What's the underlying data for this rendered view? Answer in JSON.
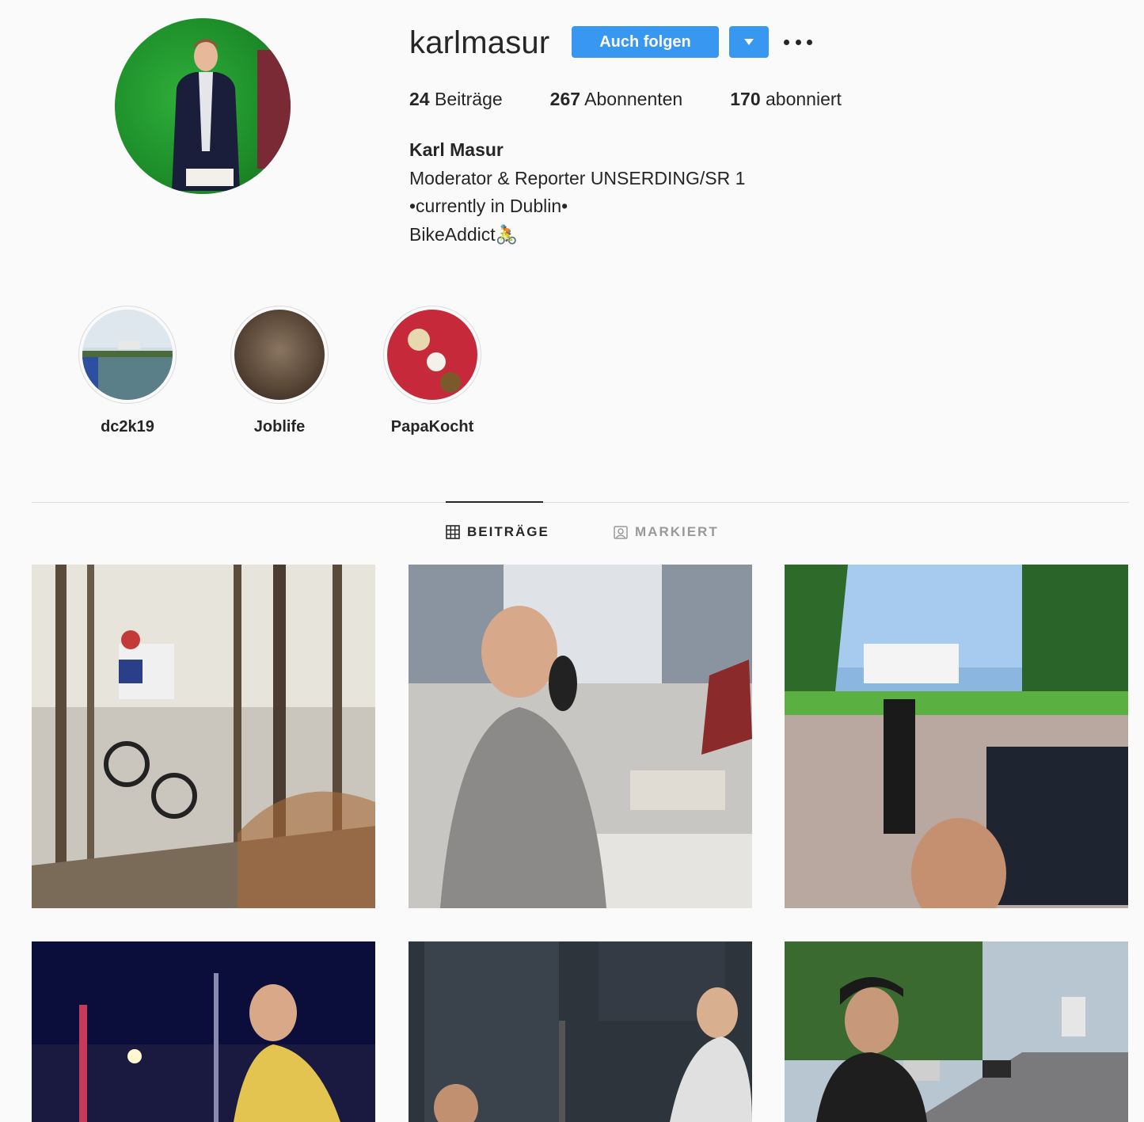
{
  "profile": {
    "username": "karlmasur",
    "follow_button": "Auch folgen",
    "stats": [
      {
        "count": "24",
        "label": "Beiträge"
      },
      {
        "count": "267",
        "label": "Abonnenten"
      },
      {
        "count": "170",
        "label": "abonniert"
      }
    ],
    "full_name": "Karl Masur",
    "bio_lines": [
      "Moderator & Reporter UNSERDING/SR 1",
      "•currently in Dublin•",
      "BikeAddict🚴"
    ]
  },
  "highlights": [
    {
      "label": "dc2k19"
    },
    {
      "label": "Joblife"
    },
    {
      "label": "PapaKocht"
    }
  ],
  "tabs": [
    {
      "label": "BEITRÄGE",
      "icon": "grid-icon",
      "active": true
    },
    {
      "label": "MARKIERT",
      "icon": "tagged-icon",
      "active": false
    }
  ],
  "colors": {
    "accent": "#3897f0",
    "text": "#262626",
    "muted": "#999999",
    "background": "#fafafa"
  }
}
